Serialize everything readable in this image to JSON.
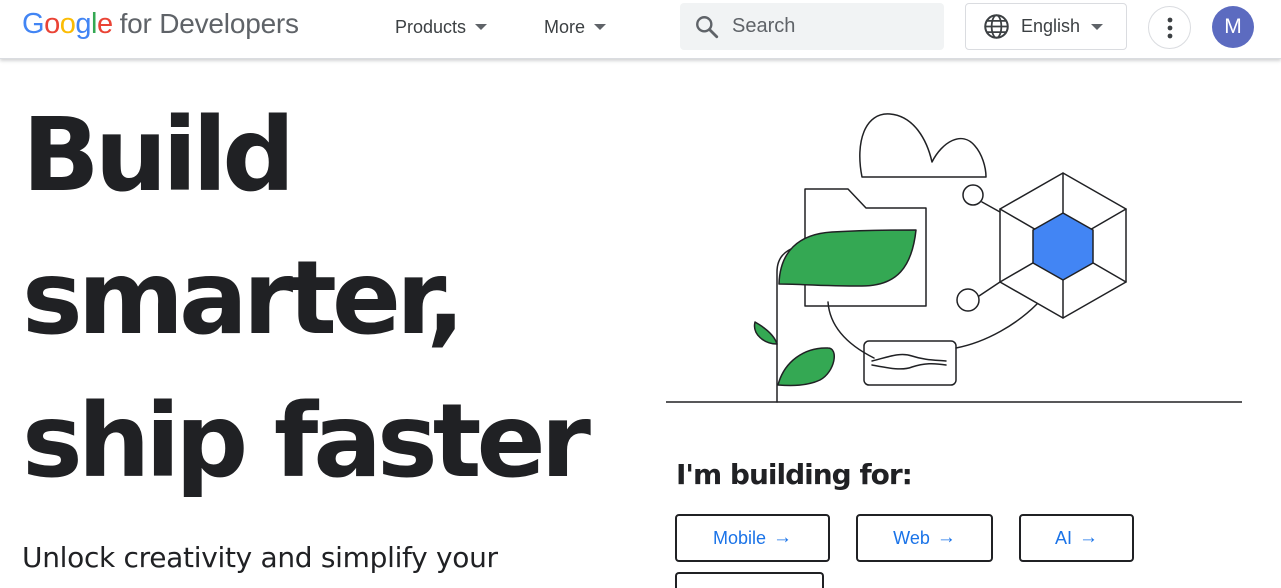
{
  "header": {
    "logo_letters": [
      {
        "char": "G",
        "color": "#4285f4"
      },
      {
        "char": "o",
        "color": "#ea4335"
      },
      {
        "char": "o",
        "color": "#fbbc04"
      },
      {
        "char": "g",
        "color": "#4285f4"
      },
      {
        "char": "l",
        "color": "#34a853"
      },
      {
        "char": "e",
        "color": "#ea4335"
      }
    ],
    "logo_rest": "for Developers",
    "nav": [
      {
        "label": "Products"
      },
      {
        "label": "More"
      }
    ],
    "search": {
      "placeholder": "Search",
      "icon": "search-icon"
    },
    "language": {
      "label": "English",
      "icon": "globe-icon"
    },
    "more_options_icon": "more-vert-icon",
    "avatar_initial": "M",
    "avatar_color": "#5c6bc0"
  },
  "hero": {
    "title_lines": [
      "Build",
      "smarter,",
      "ship faster"
    ],
    "subtitle": "Unlock creativity and simplify your"
  },
  "illustration": {
    "accent_green": "#34a853",
    "accent_blue": "#4285f4"
  },
  "building_for": {
    "heading": "I'm building for:",
    "arrow": "→",
    "buttons": [
      {
        "label": "Mobile"
      },
      {
        "label": "Web"
      },
      {
        "label": "AI"
      }
    ]
  }
}
